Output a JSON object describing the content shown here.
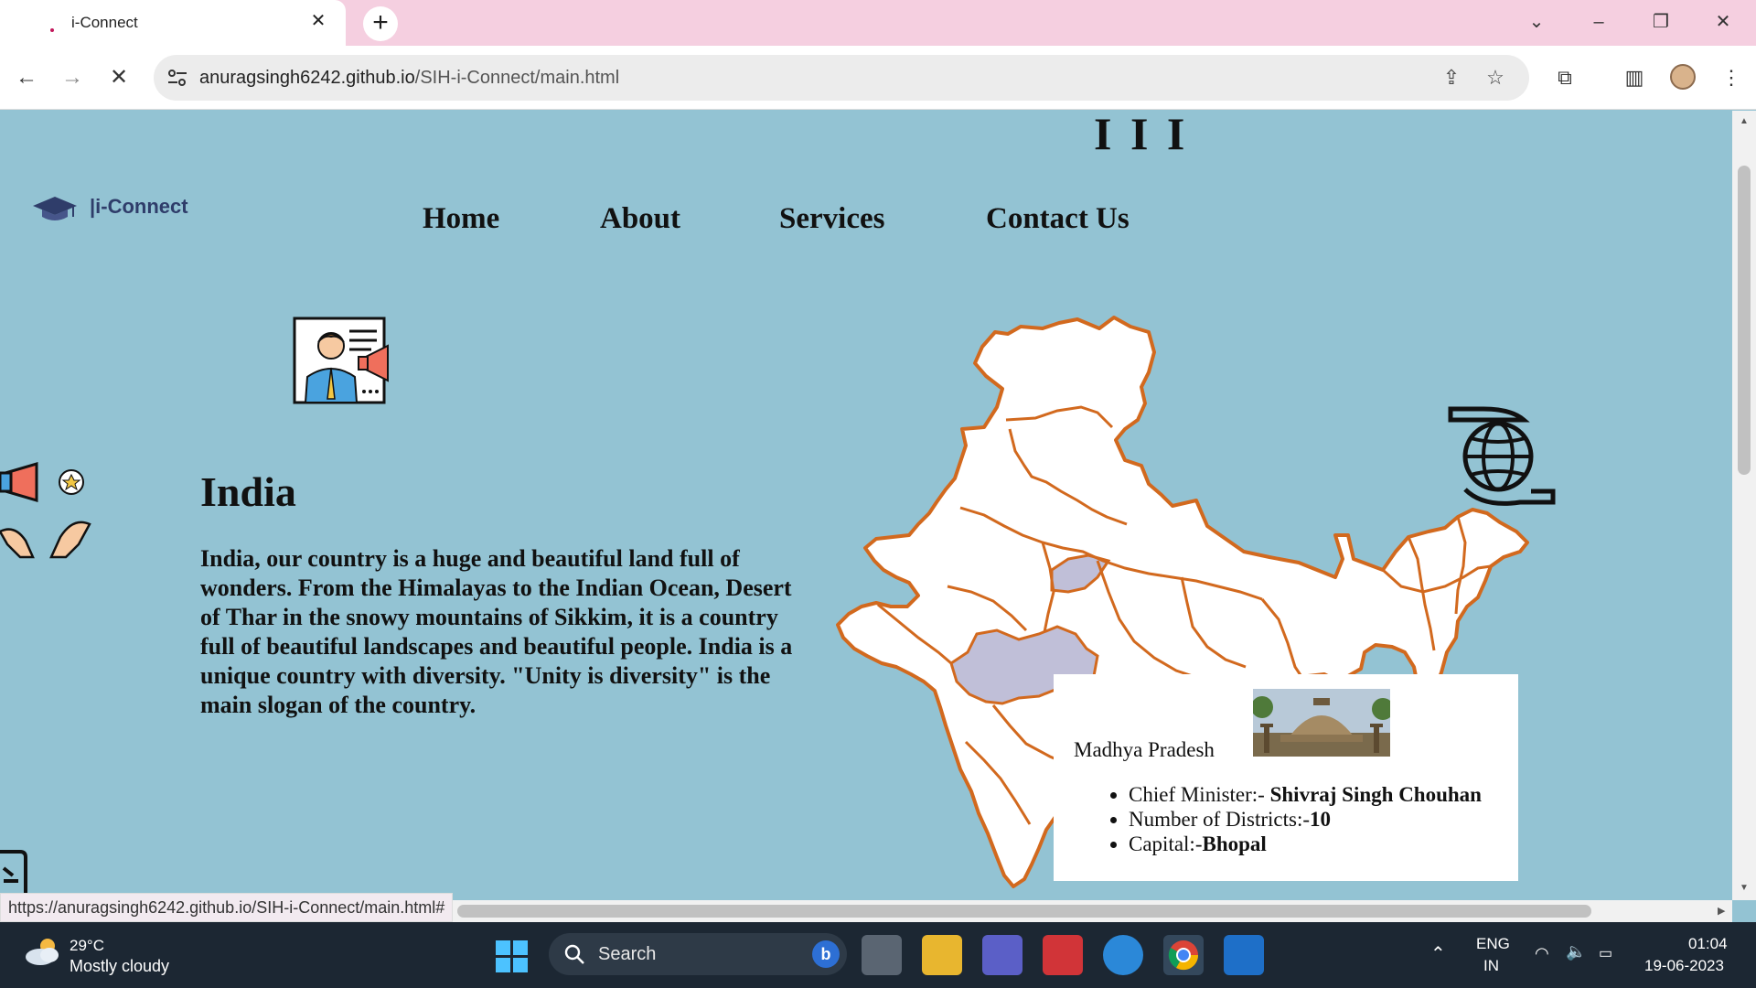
{
  "browser": {
    "tab_title": "i-Connect",
    "url_domain": "anuragsingh6242.github.io",
    "url_path": "/SIH-i-Connect/main.html",
    "status_url": "https://anuragsingh6242.github.io/SIH-i-Connect/main.html#"
  },
  "site": {
    "logo_text": "|i-Connect",
    "top_fragment": "I I I",
    "nav": [
      "Home",
      "About",
      "Services",
      "Contact Us"
    ],
    "heading": "India",
    "paragraph": "India, our country is a huge and beautiful land full of wonders. From the Himalayas to the Indian Ocean, Desert of Thar in the snowy mountains of Sikkim, it is a country full of beautiful landscapes and beautiful people. India is a unique country with diversity. \"Unity is diversity\" is the main slogan of the country.",
    "map": {
      "highlight_color": "#c0bfd8",
      "border_color": "#d2691e"
    },
    "popup": {
      "state": "Madhya Pradesh",
      "cm_label": "Chief Minister:-",
      "cm_value": "Shivraj Singh Chouhan",
      "districts_label": "Number of Districts:-",
      "districts_value": "10",
      "capital_label": "Capital:-",
      "capital_value": "Bhopal"
    }
  },
  "taskbar": {
    "temperature": "29°C",
    "condition": "Mostly cloudy",
    "search_label": "Search",
    "language": "ENG",
    "region": "IN",
    "time": "01:04",
    "date": "19-06-2023"
  }
}
